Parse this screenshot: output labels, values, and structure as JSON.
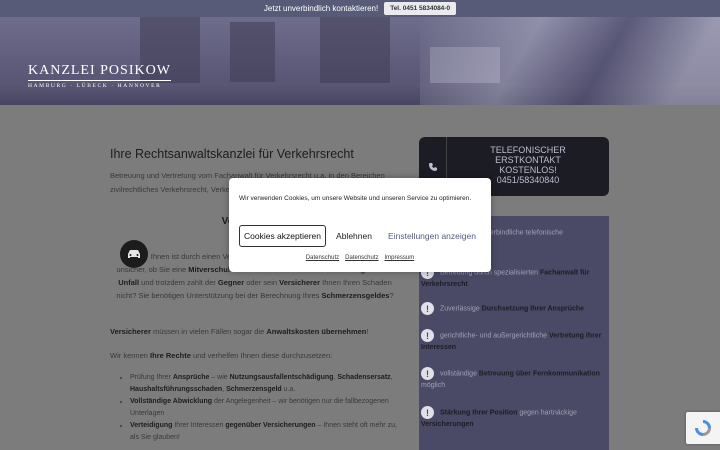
{
  "topbar": {
    "text": "Jetzt unverbindlich kontaktieren!",
    "phone": "Tel. 0451 5834084-0"
  },
  "logo": {
    "name": "KANZLEI POSIKOW",
    "cities": "HAMBURG · LÜBECK · HANNOVER"
  },
  "main": {
    "heading": "Ihre Rechtsanwaltskanzlei für Verkehrsrecht",
    "intro": "Betreuung und Vertretung vom Fachanwalt für Verkehrsrecht u.a. in den Bereichen zivilrechtliches Verkehrsrecht, Verkehrsstrafrecht und Verkehrsordnungswidrigkeiten.",
    "subheading": "Verkehrsrecht",
    "p1_a": "Ihnen ist durch einen Verkehrsunfall Schaden entstanden? Sie sind sich unsicher, ob Sie eine ",
    "p1_b": "Mitverschulden",
    "p1_c": " trifft? Sie trifft ",
    "p1_d": "keine Verantwortung an dem Unfall",
    "p1_e": " und trotzdem zahlt der ",
    "p1_f": "Gegner",
    "p1_g": " oder sein ",
    "p1_h": "Versicherer",
    "p1_i": " Ihnen Ihren Schaden nicht? Sie benötigen Unterstützung bei der Berechnung Ihres ",
    "p1_j": "Schmerzensgeldes",
    "p1_k": "?",
    "p2_a": "Versicherer",
    "p2_b": " müssen in vielen Fällen sogar die ",
    "p2_c": "Anwaltskosten übernehmen",
    "p2_d": "!",
    "p3_a": "Wir kennen ",
    "p3_b": "Ihre Rechte",
    "p3_c": " und verhelfen Ihnen diese durchzusetzen:",
    "list": [
      {
        "a": "Prüfung Ihrer ",
        "b": "Ansprüche",
        "c": " – wie ",
        "d": "Nutzungsausfallentschädigung",
        "e": ", ",
        "f": "Schadensersatz",
        "g": ", ",
        "h": "Haushaltsführungsschaden",
        "i": ", ",
        "j": "Schmerzensgeld",
        "k": " u.a."
      },
      {
        "a": "",
        "b": "Vollständige Abwicklung",
        "c": " der Angelegenheit – wir benötigen nur die fallbezogenen Unterlagen",
        "d": "",
        "e": "",
        "f": "",
        "g": "",
        "h": "",
        "i": "",
        "j": "",
        "k": ""
      },
      {
        "a": "",
        "b": "Verteidigung",
        "c": " Ihrer Interessen ",
        "d": "gegenüber Versicherungen",
        "e": " – Ihnen steht oft mehr zu, als Sie glauben!",
        "f": "",
        "g": "",
        "h": "",
        "i": "",
        "j": "",
        "k": ""
      }
    ]
  },
  "phonebox": {
    "line1": "TELEFONISCHER",
    "line2": "ERSTKONTAKT",
    "line3": "KOSTENLOS!",
    "line4": "0451/58340840"
  },
  "sidebar": {
    "items": [
      {
        "pre": "Kostenlose, unverbindliche telefonische",
        "bold": "",
        "post": ""
      },
      {
        "pre": "Betreuung durch spezialisierten ",
        "bold": "Fachanwalt für Verkehrsrecht",
        "post": ""
      },
      {
        "pre": "Zuverlässige ",
        "bold": "Durchsetzung Ihrer Ansprüche",
        "post": ""
      },
      {
        "pre": "gerichtliche- und außergerichtliche ",
        "bold": "Vertretung Ihrer Interessen",
        "post": ""
      },
      {
        "pre": "vollständige ",
        "bold": "Betreuung über Fernkommunikation",
        "post": " möglich"
      },
      {
        "pre": "",
        "bold": "Stärkung Ihrer Position",
        "post": " gegen hartnäckige "
      },
      {
        "pre": "",
        "bold": "Versicherungen",
        "post": ""
      }
    ]
  },
  "cookie": {
    "message": "Wir verwenden Cookies, um unsere Website und unseren Service zu optimieren.",
    "accept": "Cookies akzeptieren",
    "reject": "Ablehnen",
    "settings": "Einstellungen anzeigen",
    "link1": "Datenschutz",
    "link2": "Datenschutz",
    "link3": "Impressum"
  },
  "colors": {
    "topbar": "#575b78",
    "sidebar": "#4b4a66",
    "phonebox": "#1c1c24",
    "page": "#7c7c7c"
  },
  "icons": [
    "phone-icon",
    "car-icon",
    "exclamation-icon",
    "recaptcha-icon"
  ]
}
